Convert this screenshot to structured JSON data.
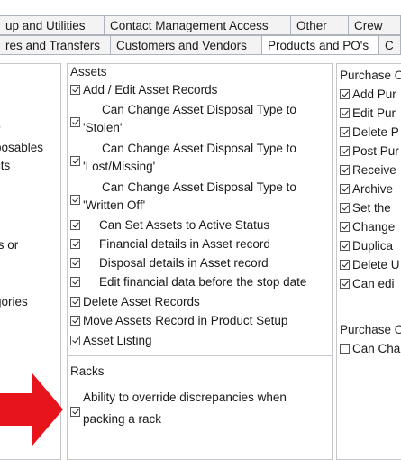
{
  "tabs_row1": [
    {
      "label": "up and Utilities",
      "width": 116
    },
    {
      "label": "Contact Management Access",
      "width": 207
    },
    {
      "label": "Other",
      "width": 64
    },
    {
      "label": "Crew",
      "width": 58
    }
  ],
  "tabs_row2": [
    {
      "label": "res and Transfers",
      "width": 123
    },
    {
      "label": "Customers and Vendors",
      "width": 168
    },
    {
      "label": "Products and PO's",
      "width": 130,
      "active": true
    },
    {
      "label": "C",
      "width": 24
    }
  ],
  "left_panel": {
    "items": [
      "s",
      "posables",
      "cts",
      "ts or",
      "gories"
    ]
  },
  "assets": {
    "title": "Assets",
    "rows": [
      {
        "label": "Add / Edit Asset Records",
        "checked": true
      },
      {
        "label": "Can Change Asset Disposal Type to",
        "label2": "'Stolen'",
        "checked": true
      },
      {
        "label": "Can Change Asset Disposal Type to",
        "label2": "'Lost/Missing'",
        "checked": true
      },
      {
        "label": "Can Change Asset Disposal Type to",
        "label2": "'Written Off'",
        "checked": true
      },
      {
        "label": "Can Set Assets to Active Status",
        "checked": true
      },
      {
        "label": "Financial details in Asset record",
        "checked": true
      },
      {
        "label": "Disposal details in Asset record",
        "checked": true
      },
      {
        "label": "Edit financial data before the stop date",
        "checked": true
      },
      {
        "label": "Delete Asset Records",
        "checked": true
      },
      {
        "label": "Move Assets Record in Product Setup",
        "checked": true
      },
      {
        "label": "Asset Listing",
        "checked": true
      }
    ]
  },
  "racks": {
    "title": "Racks",
    "row": {
      "label": "Ability to override discrepancies when",
      "label2": "packing a rack",
      "checked": true
    }
  },
  "purchase_orders": {
    "title": "Purchase O",
    "rows": [
      {
        "label": "Add Pur",
        "checked": true
      },
      {
        "label": "Edit Pur",
        "checked": true
      },
      {
        "label": "Delete P",
        "checked": true
      },
      {
        "label": "Post Pur",
        "checked": true
      },
      {
        "label": "Receive",
        "checked": true
      },
      {
        "label": "Archive",
        "checked": true
      },
      {
        "label": "Set the",
        "checked": true
      },
      {
        "label": "Change",
        "checked": true
      },
      {
        "label": "Duplica",
        "checked": true
      },
      {
        "label": "Delete U",
        "checked": true
      },
      {
        "label": "Can edi",
        "checked": true
      }
    ]
  },
  "purchase_orders2": {
    "title": "Purchase O",
    "row": {
      "label": "Can Cha",
      "checked": false
    }
  },
  "colors": {
    "arrow": "#e8141c",
    "border": "#c4c8cc",
    "tab_bg": "#f3f3f3"
  }
}
